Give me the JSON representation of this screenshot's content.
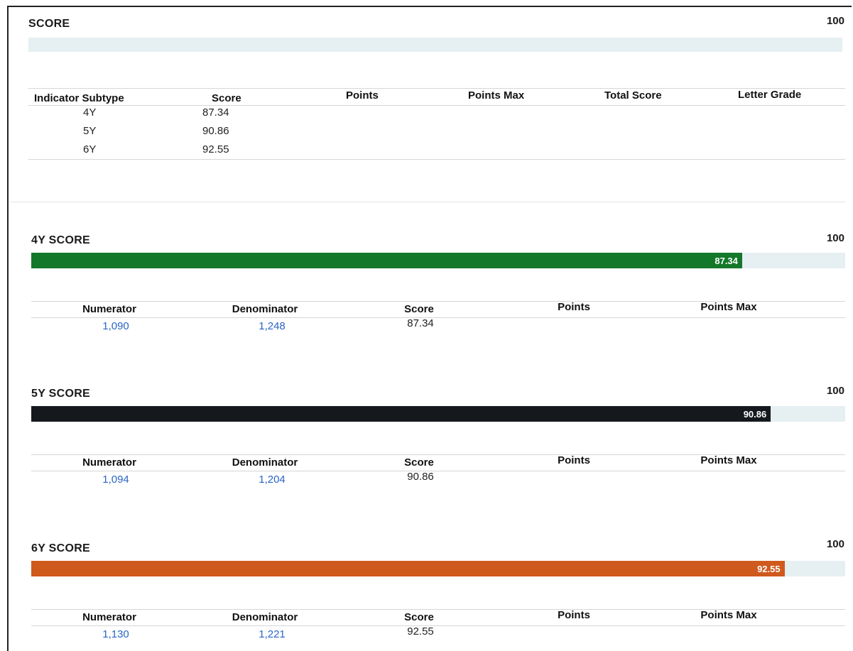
{
  "summary": {
    "title": "SCORE",
    "max_label": "100",
    "columns": [
      "Indicator Subtype",
      "Score",
      "Points",
      "Points Max",
      "Total Score",
      "Letter Grade"
    ],
    "rows": [
      {
        "subtype": "4Y",
        "score": "87.34"
      },
      {
        "subtype": "5Y",
        "score": "90.86"
      },
      {
        "subtype": "6Y",
        "score": "92.55"
      }
    ]
  },
  "sections": [
    {
      "title": "4Y SCORE",
      "max_label": "100",
      "value": 87.34,
      "value_label": "87.34",
      "bar_color": "#14782a",
      "columns": [
        "Numerator",
        "Denominator",
        "Score",
        "Points",
        "Points Max"
      ],
      "numerator": "1,090",
      "denominator": "1,248",
      "score": "87.34"
    },
    {
      "title": "5Y SCORE",
      "max_label": "100",
      "value": 90.86,
      "value_label": "90.86",
      "bar_color": "#15191e",
      "columns": [
        "Numerator",
        "Denominator",
        "Score",
        "Points",
        "Points Max"
      ],
      "numerator": "1,094",
      "denominator": "1,204",
      "score": "90.86"
    },
    {
      "title": "6Y SCORE",
      "max_label": "100",
      "value": 92.55,
      "value_label": "92.55",
      "bar_color": "#cf5a1d",
      "columns": [
        "Numerator",
        "Denominator",
        "Score",
        "Points",
        "Points Max"
      ],
      "numerator": "1,130",
      "denominator": "1,221",
      "score": "92.55"
    }
  ]
}
